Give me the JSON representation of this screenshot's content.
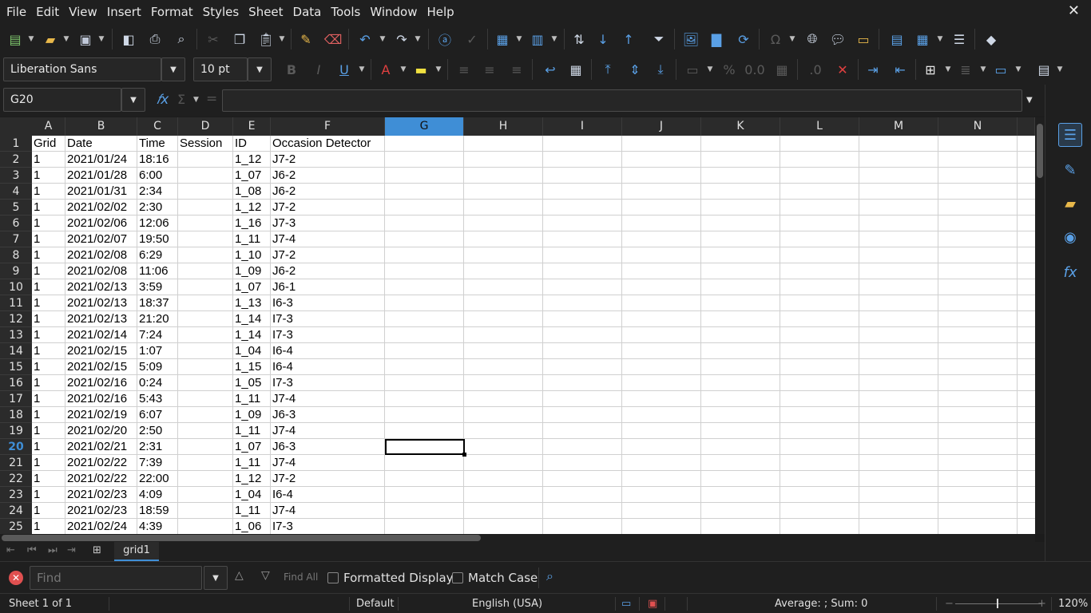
{
  "menu": [
    "File",
    "Edit",
    "View",
    "Insert",
    "Format",
    "Styles",
    "Sheet",
    "Data",
    "Tools",
    "Window",
    "Help"
  ],
  "window_close": "✕",
  "formatting": {
    "font_name": "Liberation Sans",
    "font_size": "10 pt"
  },
  "formula": {
    "name_box": "G20",
    "fx": "𝑓x",
    "sigma": "Σ",
    "equals": "=",
    "content": ""
  },
  "columns": [
    "A",
    "B",
    "C",
    "D",
    "E",
    "F",
    "G",
    "H",
    "I",
    "J",
    "K",
    "L",
    "M",
    "N"
  ],
  "selected_column": "G",
  "selected_row": 20,
  "selected_cell": "G20",
  "header_row": [
    "Grid",
    "Date",
    "Time",
    "Session",
    "ID",
    "Occasion Detector"
  ],
  "rows": [
    [
      "1",
      "2021/01/24",
      "18:16",
      "",
      "1_12",
      "J7-2"
    ],
    [
      "1",
      "2021/01/28",
      "6:00",
      "",
      "1_07",
      "J6-2"
    ],
    [
      "1",
      "2021/01/31",
      "2:34",
      "",
      "1_08",
      "J6-2"
    ],
    [
      "1",
      "2021/02/02",
      "2:30",
      "",
      "1_12",
      "J7-2"
    ],
    [
      "1",
      "2021/02/06",
      "12:06",
      "",
      "1_16",
      "J7-3"
    ],
    [
      "1",
      "2021/02/07",
      "19:50",
      "",
      "1_11",
      "J7-4"
    ],
    [
      "1",
      "2021/02/08",
      "6:29",
      "",
      "1_10",
      "J7-2"
    ],
    [
      "1",
      "2021/02/08",
      "11:06",
      "",
      "1_09",
      "J6-2"
    ],
    [
      "1",
      "2021/02/13",
      "3:59",
      "",
      "1_07",
      "J6-1"
    ],
    [
      "1",
      "2021/02/13",
      "18:37",
      "",
      "1_13",
      "I6-3"
    ],
    [
      "1",
      "2021/02/13",
      "21:20",
      "",
      "1_14",
      "I7-3"
    ],
    [
      "1",
      "2021/02/14",
      "7:24",
      "",
      "1_14",
      "I7-3"
    ],
    [
      "1",
      "2021/02/15",
      "1:07",
      "",
      "1_04",
      "I6-4"
    ],
    [
      "1",
      "2021/02/15",
      "5:09",
      "",
      "1_15",
      "I6-4"
    ],
    [
      "1",
      "2021/02/16",
      "0:24",
      "",
      "1_05",
      "I7-3"
    ],
    [
      "1",
      "2021/02/16",
      "5:43",
      "",
      "1_11",
      "J7-4"
    ],
    [
      "1",
      "2021/02/19",
      "6:07",
      "",
      "1_09",
      "J6-3"
    ],
    [
      "1",
      "2021/02/20",
      "2:50",
      "",
      "1_11",
      "J7-4"
    ],
    [
      "1",
      "2021/02/21",
      "2:31",
      "",
      "1_07",
      "J6-3"
    ],
    [
      "1",
      "2021/02/22",
      "7:39",
      "",
      "1_11",
      "J7-4"
    ],
    [
      "1",
      "2021/02/22",
      "22:00",
      "",
      "1_12",
      "J7-2"
    ],
    [
      "1",
      "2021/02/23",
      "4:09",
      "",
      "1_04",
      "I6-4"
    ],
    [
      "1",
      "2021/02/23",
      "18:59",
      "",
      "1_11",
      "J7-4"
    ],
    [
      "1",
      "2021/02/24",
      "4:39",
      "",
      "1_06",
      "I7-3"
    ]
  ],
  "row_numbers": [
    "1",
    "2",
    "3",
    "4",
    "5",
    "6",
    "7",
    "8",
    "9",
    "10",
    "11",
    "12",
    "13",
    "14",
    "15",
    "16",
    "17",
    "18",
    "19",
    "20",
    "21",
    "22",
    "23",
    "24",
    "25"
  ],
  "sheet_tab": "grid1",
  "findbar": {
    "placeholder": "Find",
    "find_all": "Find All",
    "formatted_display": "Formatted Display",
    "match_case": "Match Case"
  },
  "status": {
    "sheet": "Sheet 1 of 1",
    "page_style": "Default",
    "language": "English (USA)",
    "summary": "Average: ; Sum: 0",
    "zoom": "120%"
  },
  "colors": {
    "selection": "#3f8ed6",
    "background": "#1f1f1f",
    "grid": "#d0d0d0"
  }
}
